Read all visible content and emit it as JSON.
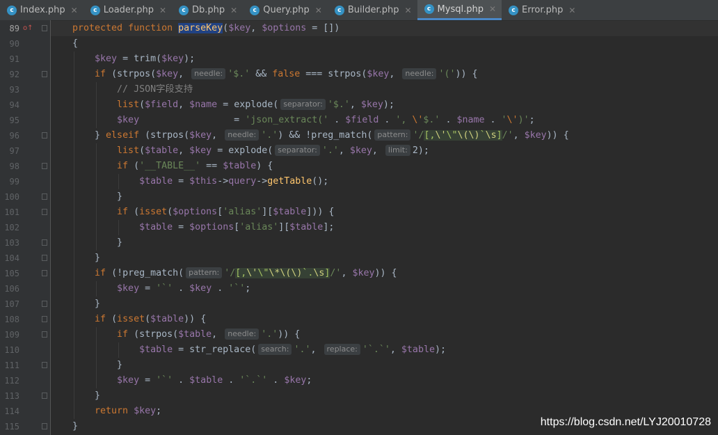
{
  "tabs": [
    {
      "label": "Index.php",
      "icon": "php-class-icon",
      "active": false
    },
    {
      "label": "Loader.php",
      "icon": "php-class-icon",
      "active": false
    },
    {
      "label": "Db.php",
      "icon": "php-class-icon",
      "active": false
    },
    {
      "label": "Query.php",
      "icon": "php-class-icon",
      "active": false
    },
    {
      "label": "Builder.php",
      "icon": "php-class-icon",
      "active": false
    },
    {
      "label": "Mysql.php",
      "icon": "php-class-icon",
      "active": true
    },
    {
      "label": "Error.php",
      "icon": "php-class-icon",
      "active": false
    }
  ],
  "editor": {
    "current_line": 89,
    "lines": [
      {
        "n": "89",
        "indent": 0,
        "fold": true,
        "current": true,
        "tokens": [
          [
            "kw",
            "protected "
          ],
          [
            "kw",
            "function "
          ],
          [
            "sel fn",
            "parseKey"
          ],
          [
            "",
            "("
          ],
          [
            "var",
            "$key"
          ],
          [
            "",
            ", "
          ],
          [
            "var",
            "$options"
          ],
          [
            "",
            " = [])"
          ]
        ]
      },
      {
        "n": "90",
        "indent": 0,
        "fold": false,
        "tokens": [
          [
            "",
            "{"
          ]
        ]
      },
      {
        "n": "91",
        "indent": 1,
        "fold": false,
        "tokens": [
          [
            "var",
            "$key"
          ],
          [
            "",
            " = trim("
          ],
          [
            "var",
            "$key"
          ],
          [
            "",
            ");"
          ]
        ]
      },
      {
        "n": "92",
        "indent": 1,
        "fold": true,
        "tokens": [
          [
            "kw",
            "if "
          ],
          [
            "",
            "(strpos("
          ],
          [
            "var",
            "$key"
          ],
          [
            "",
            ", "
          ],
          [
            "hint",
            "needle:"
          ],
          [
            "str",
            "'$.'"
          ],
          [
            "",
            " && "
          ],
          [
            "kw",
            "false"
          ],
          [
            "",
            " === strpos("
          ],
          [
            "var",
            "$key"
          ],
          [
            "",
            ", "
          ],
          [
            "hint",
            "needle:"
          ],
          [
            "str",
            "'('"
          ],
          [
            "",
            ")) {"
          ]
        ]
      },
      {
        "n": "93",
        "indent": 2,
        "fold": false,
        "tokens": [
          [
            "cmt",
            "// JSON字段支持"
          ]
        ]
      },
      {
        "n": "94",
        "indent": 2,
        "fold": false,
        "tokens": [
          [
            "kw",
            "list"
          ],
          [
            "",
            "("
          ],
          [
            "var",
            "$field"
          ],
          [
            "",
            ", "
          ],
          [
            "var",
            "$name"
          ],
          [
            "",
            " = explode("
          ],
          [
            "hint",
            "separator:"
          ],
          [
            "str",
            "'$.'"
          ],
          [
            "",
            ", "
          ],
          [
            "var",
            "$key"
          ],
          [
            "",
            ");"
          ]
        ]
      },
      {
        "n": "95",
        "indent": 2,
        "fold": false,
        "tokens": [
          [
            "var",
            "$key"
          ],
          [
            "",
            "                 = "
          ],
          [
            "str",
            "'json_extract(' "
          ],
          [
            "",
            ". "
          ],
          [
            "var",
            "$field"
          ],
          [
            "",
            " . "
          ],
          [
            "str",
            "', "
          ],
          [
            "esc",
            "\\'"
          ],
          [
            "str",
            "$.' "
          ],
          [
            "",
            ". "
          ],
          [
            "var",
            "$name"
          ],
          [
            "",
            " . "
          ],
          [
            "str",
            "'"
          ],
          [
            "esc",
            "\\'"
          ],
          [
            "str",
            ")'"
          ],
          [
            "",
            ";"
          ]
        ]
      },
      {
        "n": "96",
        "indent": 1,
        "fold": true,
        "tokens": [
          [
            "",
            "} "
          ],
          [
            "kw",
            "elseif "
          ],
          [
            "",
            "(strpos("
          ],
          [
            "var",
            "$key"
          ],
          [
            "",
            ", "
          ],
          [
            "hint",
            "needle:"
          ],
          [
            "str",
            "'.'"
          ],
          [
            "",
            ") && !preg_match("
          ],
          [
            "hint",
            "pattern:"
          ],
          [
            "str",
            "'/"
          ],
          [
            "rx",
            "[,"
          ],
          [
            "rxe",
            "\\'"
          ],
          [
            "rx",
            "\\\""
          ],
          [
            "rxe",
            "\\(\\)"
          ],
          [
            "rx",
            "`"
          ],
          [
            "rxe",
            "\\s"
          ],
          [
            "rx",
            "]"
          ],
          [
            "str",
            "/'"
          ],
          [
            "",
            ", "
          ],
          [
            "var",
            "$key"
          ],
          [
            "",
            ")) {"
          ]
        ]
      },
      {
        "n": "97",
        "indent": 2,
        "fold": false,
        "tokens": [
          [
            "kw",
            "list"
          ],
          [
            "",
            "("
          ],
          [
            "var",
            "$table"
          ],
          [
            "",
            ", "
          ],
          [
            "var",
            "$key"
          ],
          [
            "",
            " = explode("
          ],
          [
            "hint",
            "separator:"
          ],
          [
            "str",
            "'.'"
          ],
          [
            "",
            ", "
          ],
          [
            "var",
            "$key"
          ],
          [
            "",
            ", "
          ],
          [
            "hint",
            "limit:"
          ],
          [
            "",
            "2);"
          ]
        ]
      },
      {
        "n": "98",
        "indent": 2,
        "fold": true,
        "tokens": [
          [
            "kw",
            "if "
          ],
          [
            "",
            "("
          ],
          [
            "str",
            "'__TABLE__'"
          ],
          [
            "",
            " == "
          ],
          [
            "var",
            "$table"
          ],
          [
            "",
            ") {"
          ]
        ]
      },
      {
        "n": "99",
        "indent": 3,
        "fold": false,
        "tokens": [
          [
            "var",
            "$table"
          ],
          [
            "",
            " = "
          ],
          [
            "var",
            "$this"
          ],
          [
            "",
            "->"
          ],
          [
            "var",
            "query"
          ],
          [
            "",
            "->"
          ],
          [
            "fn",
            "getTable"
          ],
          [
            "",
            "();"
          ]
        ]
      },
      {
        "n": "100",
        "indent": 2,
        "fold": true,
        "tokens": [
          [
            "",
            "}"
          ]
        ]
      },
      {
        "n": "101",
        "indent": 2,
        "fold": true,
        "tokens": [
          [
            "kw",
            "if "
          ],
          [
            "",
            "("
          ],
          [
            "kw",
            "isset"
          ],
          [
            "",
            "("
          ],
          [
            "var",
            "$options"
          ],
          [
            "",
            "["
          ],
          [
            "str",
            "'alias'"
          ],
          [
            "",
            "]["
          ],
          [
            "var",
            "$table"
          ],
          [
            "",
            "])) {"
          ]
        ]
      },
      {
        "n": "102",
        "indent": 3,
        "fold": false,
        "tokens": [
          [
            "var",
            "$table"
          ],
          [
            "",
            " = "
          ],
          [
            "var",
            "$options"
          ],
          [
            "",
            "["
          ],
          [
            "str",
            "'alias'"
          ],
          [
            "",
            "]["
          ],
          [
            "var",
            "$table"
          ],
          [
            "",
            "];"
          ]
        ]
      },
      {
        "n": "103",
        "indent": 2,
        "fold": true,
        "tokens": [
          [
            "",
            "}"
          ]
        ]
      },
      {
        "n": "104",
        "indent": 1,
        "fold": true,
        "tokens": [
          [
            "",
            "}"
          ]
        ]
      },
      {
        "n": "105",
        "indent": 1,
        "fold": true,
        "tokens": [
          [
            "kw",
            "if "
          ],
          [
            "",
            "(!preg_match("
          ],
          [
            "hint",
            "pattern:"
          ],
          [
            "str",
            "'/"
          ],
          [
            "rx",
            "[,"
          ],
          [
            "rxe",
            "\\'"
          ],
          [
            "rx",
            "\\\""
          ],
          [
            "rxe",
            "\\*\\(\\)"
          ],
          [
            "rx",
            "`."
          ],
          [
            "rxe",
            "\\s"
          ],
          [
            "rx",
            "]"
          ],
          [
            "str",
            "/'"
          ],
          [
            "",
            ", "
          ],
          [
            "var",
            "$key"
          ],
          [
            "",
            ")) {"
          ]
        ]
      },
      {
        "n": "106",
        "indent": 2,
        "fold": false,
        "tokens": [
          [
            "var",
            "$key"
          ],
          [
            "",
            " = "
          ],
          [
            "str",
            "'`'"
          ],
          [
            "",
            " . "
          ],
          [
            "var",
            "$key"
          ],
          [
            "",
            " . "
          ],
          [
            "str",
            "'`'"
          ],
          [
            "",
            ";"
          ]
        ]
      },
      {
        "n": "107",
        "indent": 1,
        "fold": true,
        "tokens": [
          [
            "",
            "}"
          ]
        ]
      },
      {
        "n": "108",
        "indent": 1,
        "fold": true,
        "tokens": [
          [
            "kw",
            "if "
          ],
          [
            "",
            "("
          ],
          [
            "kw",
            "isset"
          ],
          [
            "",
            "("
          ],
          [
            "var",
            "$table"
          ],
          [
            "",
            ")) {"
          ]
        ]
      },
      {
        "n": "109",
        "indent": 2,
        "fold": true,
        "tokens": [
          [
            "kw",
            "if "
          ],
          [
            "",
            "(strpos("
          ],
          [
            "var",
            "$table"
          ],
          [
            "",
            ", "
          ],
          [
            "hint",
            "needle:"
          ],
          [
            "str",
            "'.'"
          ],
          [
            "",
            ")) {"
          ]
        ]
      },
      {
        "n": "110",
        "indent": 3,
        "fold": false,
        "tokens": [
          [
            "var",
            "$table"
          ],
          [
            "",
            " = str_replace("
          ],
          [
            "hint",
            "search:"
          ],
          [
            "str",
            "'.'"
          ],
          [
            "",
            ", "
          ],
          [
            "hint",
            "replace:"
          ],
          [
            "str",
            "'`.`'"
          ],
          [
            "",
            ", "
          ],
          [
            "var",
            "$table"
          ],
          [
            "",
            ");"
          ]
        ]
      },
      {
        "n": "111",
        "indent": 2,
        "fold": true,
        "tokens": [
          [
            "",
            "}"
          ]
        ]
      },
      {
        "n": "112",
        "indent": 2,
        "fold": false,
        "tokens": [
          [
            "var",
            "$key"
          ],
          [
            "",
            " = "
          ],
          [
            "str",
            "'`'"
          ],
          [
            "",
            " . "
          ],
          [
            "var",
            "$table"
          ],
          [
            "",
            " . "
          ],
          [
            "str",
            "'`.`'"
          ],
          [
            "",
            " . "
          ],
          [
            "var",
            "$key"
          ],
          [
            "",
            ";"
          ]
        ]
      },
      {
        "n": "113",
        "indent": 1,
        "fold": true,
        "tokens": [
          [
            "",
            "}"
          ]
        ]
      },
      {
        "n": "114",
        "indent": 1,
        "fold": false,
        "tokens": [
          [
            "kw",
            "return "
          ],
          [
            "var",
            "$key"
          ],
          [
            "",
            ";"
          ]
        ]
      },
      {
        "n": "115",
        "indent": 0,
        "fold": true,
        "tokens": [
          [
            "",
            "}"
          ]
        ]
      }
    ]
  },
  "gutter_mark": {
    "icon": "override-method-icon",
    "glyph": "o↑",
    "color": "#c75450"
  },
  "watermark": "https://blog.csdn.net/LYJ20010728"
}
